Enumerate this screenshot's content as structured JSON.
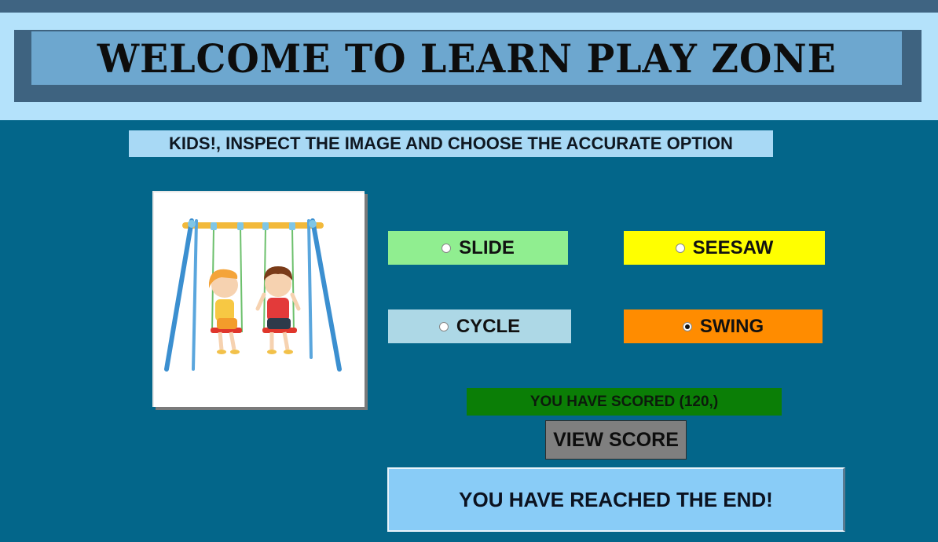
{
  "header": {
    "title": "WELCOME TO LEARN PLAY ZONE"
  },
  "instruction": "KIDS!, INSPECT THE IMAGE AND CHOOSE THE ACCURATE OPTION",
  "picture": {
    "icon": "kids-on-swing-illustration"
  },
  "options": [
    {
      "label": "SLIDE",
      "color": "#90ee90",
      "selected": false
    },
    {
      "label": "SEESAW",
      "color": "#ffff00",
      "selected": false
    },
    {
      "label": "CYCLE",
      "color": "#add8e6",
      "selected": false
    },
    {
      "label": "SWING",
      "color": "#ff8c00",
      "selected": true
    }
  ],
  "score_text": "YOU HAVE SCORED (120,)",
  "view_score_label": "VIEW SCORE",
  "end_message": "YOU HAVE REACHED THE END!",
  "colors": {
    "background": "#03668a",
    "header_frame": "#3f6482",
    "header_bevel": "#b4e2fb",
    "title_bg": "#6da7cf",
    "score_bg": "#0b7e06",
    "end_bg": "#89ccf7"
  }
}
